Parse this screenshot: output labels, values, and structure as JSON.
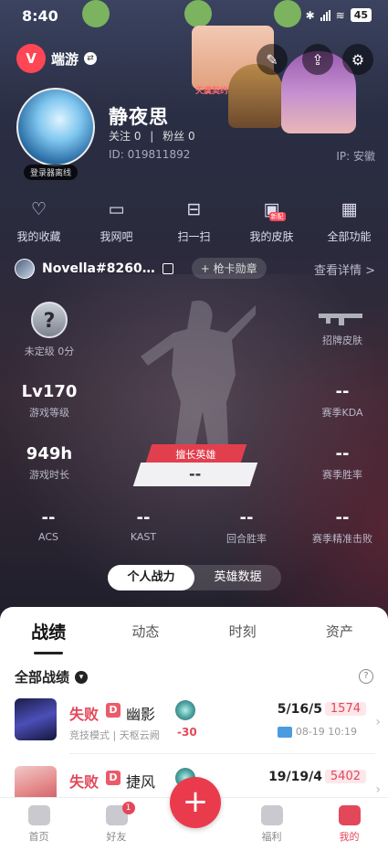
{
  "status_bar": {
    "time": "8:40",
    "battery": "45"
  },
  "header": {
    "app_name": "端游",
    "banner_text": "天虞契约2周年"
  },
  "profile": {
    "nickname": "静夜思",
    "follow_label": "关注 0",
    "fans_label": "粉丝 0",
    "separator": "|",
    "uid": "ID: 019811892",
    "ip": "IP: 安徽",
    "login_status": "登录器离线"
  },
  "shortcuts": [
    {
      "label": "我的收藏",
      "icon": "heart-icon"
    },
    {
      "label": "我网吧",
      "icon": "monitor-icon"
    },
    {
      "label": "扫一扫",
      "icon": "scan-icon"
    },
    {
      "label": "我的皮肤",
      "icon": "skin-icon",
      "tag": "新配"
    },
    {
      "label": "全部功能",
      "icon": "grid-icon"
    }
  ],
  "player": {
    "tag": "Novella#8260…",
    "badge_button": "+ 枪卡勋章",
    "detail_link": "查看详情 >"
  },
  "stats": {
    "rank": {
      "value": "?",
      "label": "未定级 0分"
    },
    "skin": {
      "label": "招牌皮肤"
    },
    "level": {
      "value": "Lv170",
      "label": "游戏等级"
    },
    "kda": {
      "value": "--",
      "label": "赛季KDA"
    },
    "hours": {
      "value": "949h",
      "label": "游戏时长"
    },
    "winrate": {
      "value": "--",
      "label": "赛季胜率"
    },
    "hero_label": "擅长英雄",
    "hero_value": "--",
    "acs": {
      "value": "--",
      "label": "ACS"
    },
    "kast": {
      "value": "--",
      "label": "KAST"
    },
    "round_win": {
      "value": "--",
      "label": "回合胜率"
    },
    "precision": {
      "value": "--",
      "label": "赛季精准击败"
    }
  },
  "segmented": {
    "left": "个人战力",
    "right": "英雄数据"
  },
  "panel": {
    "tabs": [
      "战绩",
      "动态",
      "时刻",
      "资产"
    ],
    "filter": "全部战绩",
    "help": "?",
    "matches": [
      {
        "result": "失败",
        "grade": "D",
        "agent": "幽影",
        "mode": "竞技模式 | 天枢云阙",
        "delta": "-30",
        "kda": "5/16/5",
        "score": "1574",
        "date": "08-19 10:19",
        "avatar_color": "#3a3f8f"
      },
      {
        "result": "失败",
        "grade": "D",
        "agent": "捷风",
        "mode": "",
        "delta": "",
        "kda": "19/19/4",
        "score": "5402",
        "date": "",
        "avatar_color": "#e8a8a8"
      }
    ]
  },
  "nav": {
    "items": [
      "首页",
      "好友",
      "",
      "福利",
      "我的"
    ],
    "friend_badge": "1",
    "plus": "+"
  }
}
